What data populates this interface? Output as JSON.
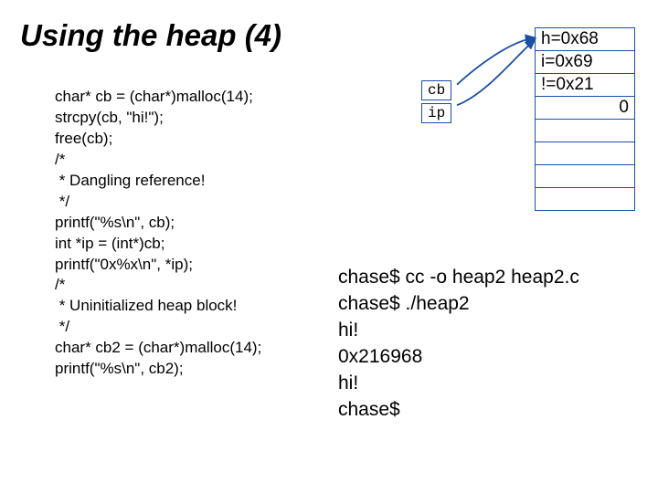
{
  "title": "Using the heap (4)",
  "code": {
    "l1": "char* cb = (char*)malloc(14);",
    "l2": "strcpy(cb, \"hi!\");",
    "l3": "free(cb);",
    "l4": "/*",
    "l5": " * Dangling reference!",
    "l6": " */",
    "l7": "printf(\"%s\\n\", cb);",
    "l8": "int *ip = (int*)cb;",
    "l9": "printf(\"0x%x\\n\", *ip);",
    "l10": "/*",
    "l11": " * Uninitialized heap block!",
    "l12": " */",
    "l13": "char* cb2 = (char*)malloc(14);",
    "l14": "printf(\"%s\\n\", cb2);"
  },
  "pointers": {
    "cb": "cb",
    "ip": "ip"
  },
  "memory": {
    "r0": "h=0x68",
    "r1": "i=0x69",
    "r2": "!=0x21",
    "r3": "0"
  },
  "terminal": {
    "t1": "chase$ cc -o heap2 heap2.c",
    "t2": "chase$ ./heap2",
    "t3": "hi!",
    "t4": "0x216968",
    "t5": "hi!",
    "t6": "chase$"
  }
}
